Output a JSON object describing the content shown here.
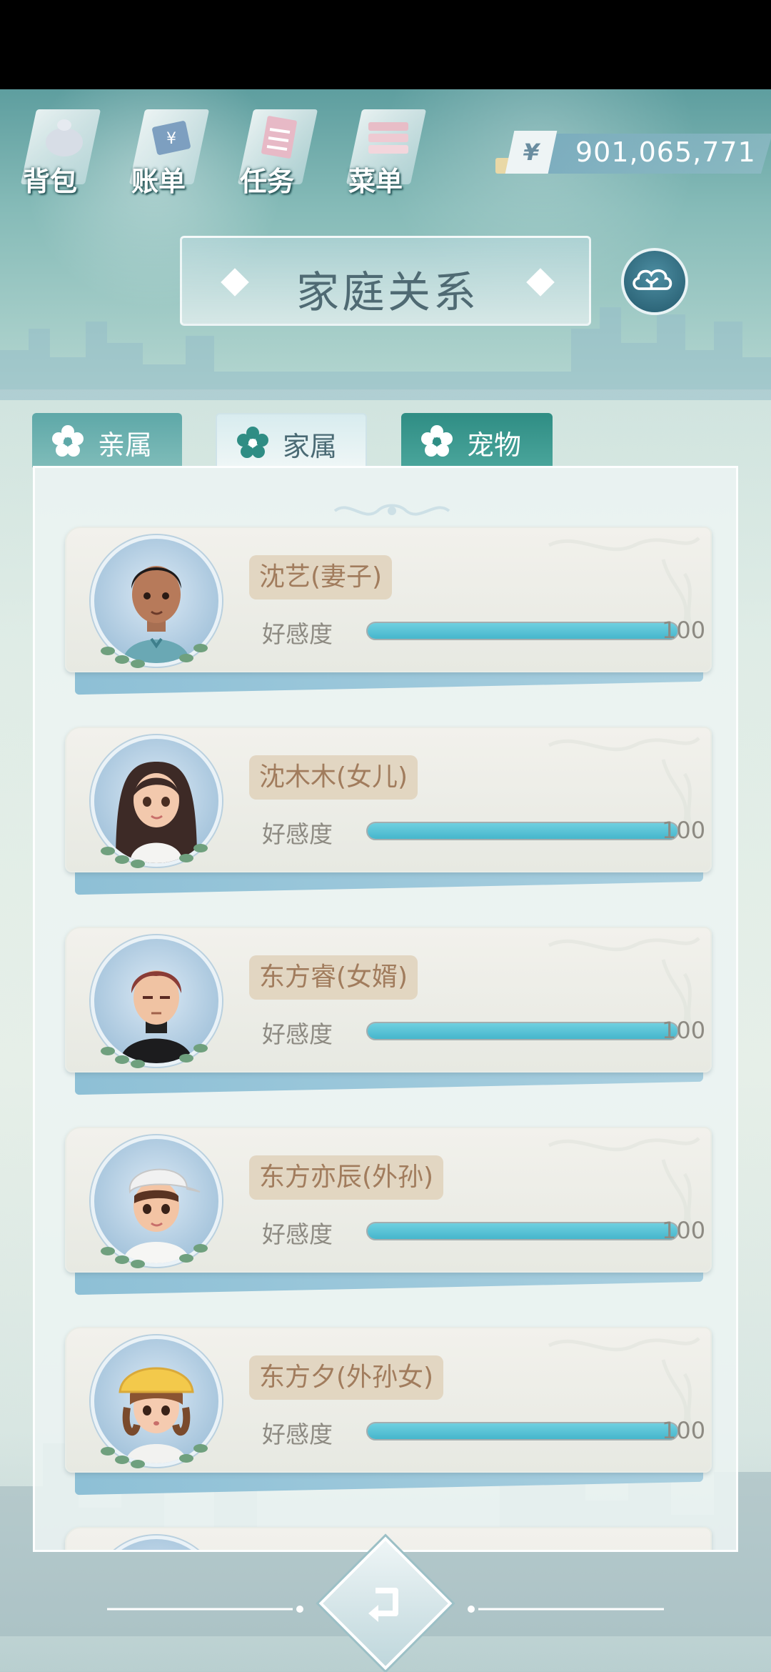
{
  "topmenu": {
    "items": [
      {
        "label": "背包",
        "icon": "bag-icon"
      },
      {
        "label": "账单",
        "icon": "bill-icon"
      },
      {
        "label": "任务",
        "icon": "task-icon"
      },
      {
        "label": "菜单",
        "icon": "menu-icon"
      }
    ]
  },
  "currency": {
    "symbol": "¥",
    "amount": "901,065,771"
  },
  "title": "家庭关系",
  "tabs": [
    {
      "label": "亲属",
      "icon": "flower-icon",
      "active": false
    },
    {
      "label": "家属",
      "icon": "flower-icon",
      "active": true
    },
    {
      "label": "宠物",
      "icon": "flower-icon",
      "active": false
    }
  ],
  "members": [
    {
      "name": "沈艺(妻子)",
      "affinity_label": "好感度",
      "affinity": 100,
      "affinity_max": 100
    },
    {
      "name": "沈木木(女儿)",
      "affinity_label": "好感度",
      "affinity": 100,
      "affinity_max": 100
    },
    {
      "name": "东方睿(女婿)",
      "affinity_label": "好感度",
      "affinity": 100,
      "affinity_max": 100
    },
    {
      "name": "东方亦辰(外孙)",
      "affinity_label": "好感度",
      "affinity": 100,
      "affinity_max": 100
    },
    {
      "name": "东方夕(外孙女)",
      "affinity_label": "好感度",
      "affinity": 100,
      "affinity_max": 100
    }
  ],
  "colors": {
    "affinity_bar": "#46b6cc",
    "name_tag_text": "#a17c5d",
    "tab_active": "#d8ecef",
    "tab_relatives": "#5ea8a8",
    "tab_pets": "#2f8d84"
  }
}
